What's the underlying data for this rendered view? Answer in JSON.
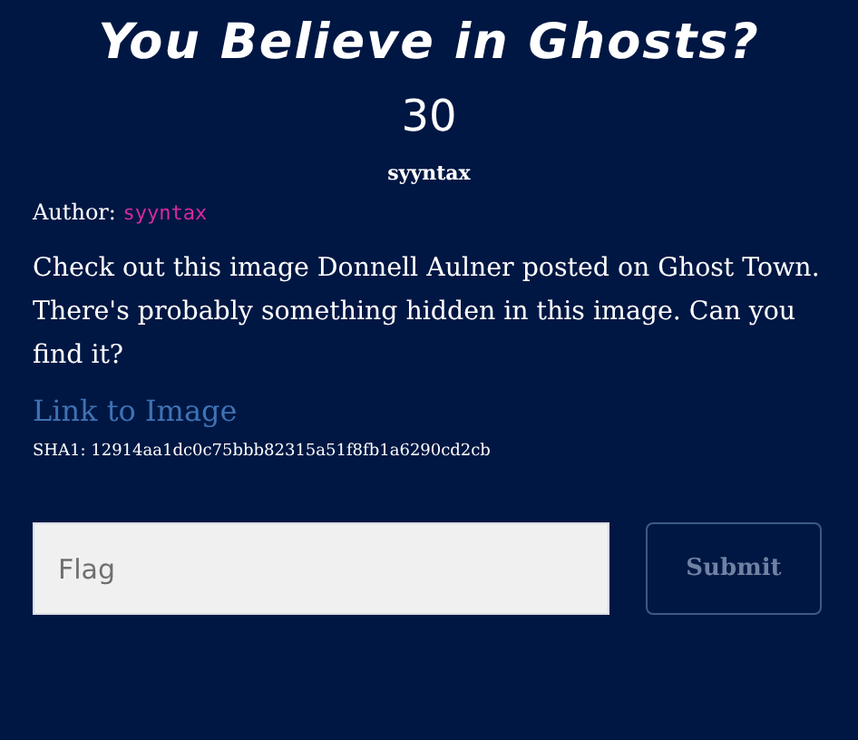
{
  "challenge": {
    "title": "You Believe in Ghosts?",
    "points": "30",
    "category": "syyntax",
    "author_label": "Author:",
    "author": "syyntax",
    "description": "Check out this image Donnell Aulner posted on Ghost Town. There's probably something hidden in this image. Can you find it?",
    "link": "Link to Image",
    "hash": "SHA1: 12914aa1dc0c75bbb82315a51f8fb1a6290cd2cb"
  },
  "form": {
    "placeholder": "Flag",
    "submit": "Submit"
  }
}
